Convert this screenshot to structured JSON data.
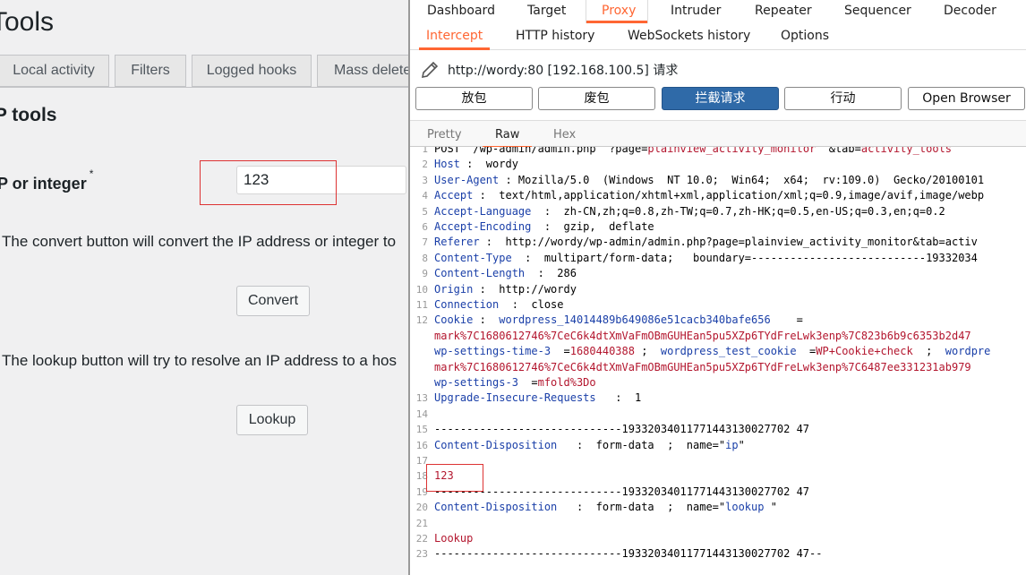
{
  "wp": {
    "title": "Tools",
    "tabs": [
      "Local activity",
      "Filters",
      "Logged hooks",
      "Mass delete"
    ],
    "section_title": "IP tools",
    "field_label": "IP or integer",
    "required_mark": "*",
    "ip_value": "123",
    "convert_desc": "The convert button will convert the IP address or integer to",
    "convert_label": "Convert",
    "lookup_desc": "The lookup button will try to resolve an IP address to a hos",
    "lookup_label": "Lookup"
  },
  "burp": {
    "top_tabs": [
      "Dashboard",
      "Target",
      "Proxy",
      "Intruder",
      "Repeater",
      "Sequencer",
      "Decoder"
    ],
    "active_top_tab": "Proxy",
    "sub_tabs": [
      "Intercept",
      "HTTP history",
      "WebSockets history",
      "Options"
    ],
    "active_sub_tab": "Intercept",
    "request_target": "http://wordy:80  [192.168.100.5] 请求",
    "actions": [
      "放包",
      "废包",
      "拦截请求",
      "行动",
      "Open Browser"
    ],
    "view_tabs": [
      "Pretty",
      "Raw",
      "Hex"
    ],
    "active_view_tab": "Raw",
    "accent_color": "#ff6633",
    "primary_button_color": "#2f6aa8",
    "lines": [
      {
        "n": "1",
        "parts": [
          {
            "t": "POST  /wp-admin/admin.php  ?page=",
            "c": "hv"
          },
          {
            "t": "plainview_activity_monitor",
            "c": "red"
          },
          {
            "t": "  &tab=",
            "c": "hv"
          },
          {
            "t": "activity_tools",
            "c": "red"
          }
        ]
      },
      {
        "n": "2",
        "parts": [
          {
            "t": "Host",
            "c": "hn"
          },
          {
            "t": " :  wordy",
            "c": "hv"
          }
        ]
      },
      {
        "n": "3",
        "parts": [
          {
            "t": "User-Agent",
            "c": "hn"
          },
          {
            "t": " : Mozilla/5.0  (Windows  NT 10.0;  Win64;  x64;  rv:109.0)  Gecko/20100101",
            "c": "hv"
          }
        ]
      },
      {
        "n": "4",
        "parts": [
          {
            "t": "Accept",
            "c": "hn"
          },
          {
            "t": " :  text/html,application/xhtml+xml,application/xml;q=0.9,image/avif,image/webp",
            "c": "hv"
          }
        ]
      },
      {
        "n": "5",
        "parts": [
          {
            "t": "Accept-Language",
            "c": "hn"
          },
          {
            "t": "  :  zh-CN,zh;q=0.8,zh-TW;q=0.7,zh-HK;q=0.5,en-US;q=0.3,en;q=0.2",
            "c": "hv"
          }
        ]
      },
      {
        "n": "6",
        "parts": [
          {
            "t": "Accept-Encoding",
            "c": "hn"
          },
          {
            "t": "  :  gzip,  deflate",
            "c": "hv"
          }
        ]
      },
      {
        "n": "7",
        "parts": [
          {
            "t": "Referer",
            "c": "hn"
          },
          {
            "t": " :  http://wordy/wp-admin/admin.php?page=plainview_activity_monitor&tab=activ",
            "c": "hv"
          }
        ]
      },
      {
        "n": "8",
        "parts": [
          {
            "t": "Content-Type",
            "c": "hn"
          },
          {
            "t": "  :  multipart/form-data;   boundary=---------------------------19332034",
            "c": "hv"
          }
        ]
      },
      {
        "n": "9",
        "parts": [
          {
            "t": "Content-Length",
            "c": "hn"
          },
          {
            "t": "  :  286",
            "c": "hv"
          }
        ]
      },
      {
        "n": "10",
        "parts": [
          {
            "t": "Origin",
            "c": "hn"
          },
          {
            "t": " :  http://wordy",
            "c": "hv"
          }
        ]
      },
      {
        "n": "11",
        "parts": [
          {
            "t": "Connection",
            "c": "hn"
          },
          {
            "t": "  :  close",
            "c": "hv"
          }
        ]
      },
      {
        "n": "12",
        "parts": [
          {
            "t": "Cookie",
            "c": "hn"
          },
          {
            "t": " :  ",
            "c": "hv"
          },
          {
            "t": "wordpress_14014489b649086e51cacb340bafe656",
            "c": "blue"
          },
          {
            "t": "    =",
            "c": "hv"
          }
        ]
      },
      {
        "n": "",
        "parts": [
          {
            "t": "mark%7C1680612746%7CeC6k4dtXmVaFmOBmGUHEan5pu5XZp6TYdFreLwk3enp%7C823b6b9c6353b2d47",
            "c": "red"
          }
        ]
      },
      {
        "n": "",
        "parts": [
          {
            "t": "wp-settings-time-3",
            "c": "blue"
          },
          {
            "t": "  =",
            "c": "hv"
          },
          {
            "t": "1680440388",
            "c": "red"
          },
          {
            "t": " ;  ",
            "c": "hv"
          },
          {
            "t": "wordpress_test_cookie",
            "c": "blue"
          },
          {
            "t": "  =",
            "c": "hv"
          },
          {
            "t": "WP+Cookie+check",
            "c": "red"
          },
          {
            "t": "  ;  ",
            "c": "hv"
          },
          {
            "t": "wordpre",
            "c": "blue"
          }
        ]
      },
      {
        "n": "",
        "parts": [
          {
            "t": "mark%7C1680612746%7CeC6k4dtXmVaFmOBmGUHEan5pu5XZp6TYdFreLwk3enp%7C6487ee331231ab979",
            "c": "red"
          }
        ]
      },
      {
        "n": "",
        "parts": [
          {
            "t": "wp-settings-3",
            "c": "blue"
          },
          {
            "t": "  =",
            "c": "hv"
          },
          {
            "t": "mfold%3Do",
            "c": "red"
          }
        ]
      },
      {
        "n": "13",
        "parts": [
          {
            "t": "Upgrade-Insecure-Requests",
            "c": "hn"
          },
          {
            "t": "   :  1",
            "c": "hv"
          }
        ]
      },
      {
        "n": "14",
        "parts": []
      },
      {
        "n": "15",
        "parts": [
          {
            "t": "-----------------------------19332034011771443130027702 47",
            "c": "hv"
          }
        ]
      },
      {
        "n": "16",
        "parts": [
          {
            "t": "Content-Disposition",
            "c": "hn"
          },
          {
            "t": "   :  form-data  ;  name=\"",
            "c": "hv"
          },
          {
            "t": "ip",
            "c": "blue"
          },
          {
            "t": "\"",
            "c": "hv"
          }
        ]
      },
      {
        "n": "17",
        "parts": []
      },
      {
        "n": "18",
        "parts": [
          {
            "t": "123",
            "c": "red"
          }
        ]
      },
      {
        "n": "19",
        "parts": [
          {
            "t": "-----------------------------19332034011771443130027702 47",
            "c": "hv"
          }
        ]
      },
      {
        "n": "20",
        "parts": [
          {
            "t": "Content-Disposition",
            "c": "hn"
          },
          {
            "t": "   :  form-data  ;  name=\"",
            "c": "hv"
          },
          {
            "t": "lookup",
            "c": "blue"
          },
          {
            "t": " \"",
            "c": "hv"
          }
        ]
      },
      {
        "n": "21",
        "parts": []
      },
      {
        "n": "22",
        "parts": [
          {
            "t": "Lookup",
            "c": "red"
          }
        ]
      },
      {
        "n": "23",
        "parts": [
          {
            "t": "-----------------------------19332034011771443130027702 47--",
            "c": "hv"
          }
        ]
      }
    ]
  }
}
